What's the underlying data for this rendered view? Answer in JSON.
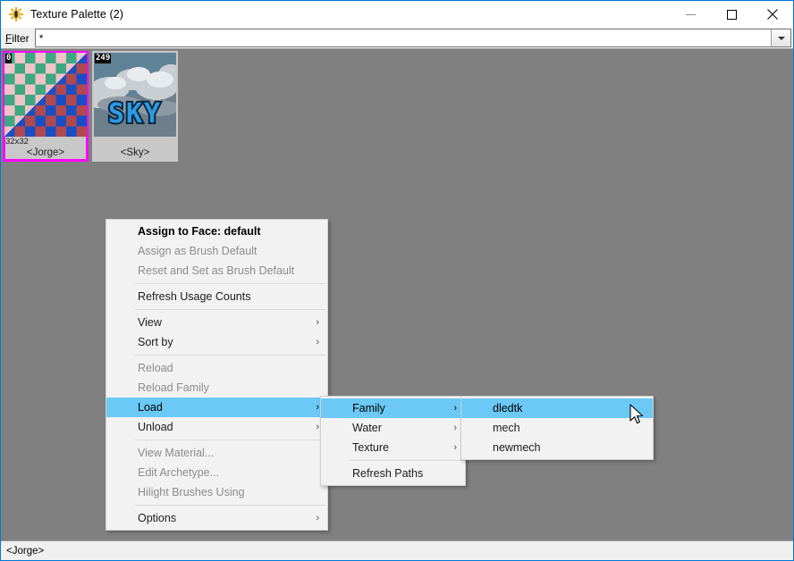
{
  "window": {
    "title": "Texture Palette (2)",
    "app_icon": "sun-gear-icon",
    "controls": {
      "minimize": "minimize-icon",
      "maximize": "maximize-icon",
      "close": "close-icon"
    },
    "accent_color": "#0078d7",
    "background_color": "#808080"
  },
  "filter": {
    "label": "Filter",
    "accel": "F",
    "value": "*",
    "placeholder": "",
    "dropdown_icon": "chevron-down-icon"
  },
  "palette": {
    "thumbnails": [
      {
        "index": "0",
        "name": "<Jorge>",
        "size": "32x32",
        "selected": true,
        "selection_color": "#ff00ff"
      },
      {
        "index": "249",
        "name": "<Sky>",
        "size": "",
        "selected": false,
        "selection_color": ""
      }
    ]
  },
  "context_menu": {
    "items": [
      {
        "label": "Assign to Face: default",
        "state": "bold",
        "submenu": false
      },
      {
        "label": "Assign as Brush Default",
        "state": "disabled",
        "submenu": false
      },
      {
        "label": "Reset and Set as Brush Default",
        "state": "disabled",
        "submenu": false
      },
      {
        "label": "__sep__",
        "state": "separator",
        "submenu": false
      },
      {
        "label": "Refresh Usage Counts",
        "state": "normal",
        "submenu": false
      },
      {
        "label": "__sep__",
        "state": "separator",
        "submenu": false
      },
      {
        "label": "View",
        "state": "normal",
        "submenu": true
      },
      {
        "label": "Sort by",
        "state": "normal",
        "submenu": true
      },
      {
        "label": "__sep__",
        "state": "separator",
        "submenu": false
      },
      {
        "label": "Reload",
        "state": "disabled",
        "submenu": false
      },
      {
        "label": "Reload Family",
        "state": "disabled",
        "submenu": false
      },
      {
        "label": "Load",
        "state": "highlight",
        "submenu": true
      },
      {
        "label": "Unload",
        "state": "normal",
        "submenu": true
      },
      {
        "label": "__sep__",
        "state": "separator",
        "submenu": false
      },
      {
        "label": "View Material...",
        "state": "disabled",
        "submenu": false
      },
      {
        "label": "Edit Archetype...",
        "state": "disabled",
        "submenu": false
      },
      {
        "label": "Hilight Brushes Using",
        "state": "disabled",
        "submenu": false
      },
      {
        "label": "__sep__",
        "state": "separator",
        "submenu": false
      },
      {
        "label": "Options",
        "state": "normal",
        "submenu": true
      }
    ]
  },
  "submenu_load": {
    "items": [
      {
        "label": "Family",
        "state": "highlight",
        "submenu": true
      },
      {
        "label": "Water",
        "state": "normal",
        "submenu": true
      },
      {
        "label": "Texture",
        "state": "normal",
        "submenu": true
      },
      {
        "label": "__sep__",
        "state": "separator",
        "submenu": false
      },
      {
        "label": "Refresh Paths",
        "state": "normal",
        "submenu": false
      }
    ]
  },
  "submenu_family": {
    "items": [
      {
        "label": "dledtk",
        "state": "highlight",
        "submenu": false
      },
      {
        "label": "mech",
        "state": "normal",
        "submenu": false
      },
      {
        "label": "newmech",
        "state": "normal",
        "submenu": false
      }
    ]
  },
  "status": {
    "text": "<Jorge>"
  },
  "colors": {
    "menu_highlight": "#6cc9f5",
    "menu_background": "#f2f2f2",
    "disabled_text": "#8c8c8c"
  }
}
